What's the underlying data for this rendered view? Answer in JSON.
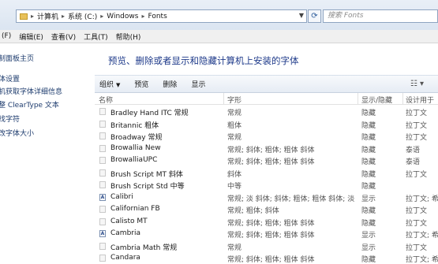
{
  "address_bar": {
    "crumbs": [
      "计算机",
      "系统 (C:)",
      "Windows",
      "Fonts"
    ],
    "search_placeholder": "搜索 Fonts"
  },
  "menu": [
    "(F)",
    "编辑(E)",
    "查看(V)",
    "工具(T)",
    "帮助(H)"
  ],
  "nav_links": [
    "制面板主页",
    "体设置",
    "机获取字体详细信息",
    "整 ClearType 文本",
    "找字符",
    "改字体大小"
  ],
  "heading": "预览、删除或者显示和隐藏计算机上安装的字体",
  "toolbar": {
    "organize": "组织",
    "preview": "预览",
    "delete": "删除",
    "show": "显示"
  },
  "columns": [
    "名称",
    "字形",
    "显示/隐藏",
    "设计用于"
  ],
  "fonts": [
    {
      "name": "Bradley Hand ITC 常规",
      "style": "常规",
      "visibility": "隐藏",
      "designed_for": "拉丁文",
      "truetype": false
    },
    {
      "name": "Britannic 粗体",
      "style": "粗体",
      "visibility": "隐藏",
      "designed_for": "拉丁文",
      "truetype": false
    },
    {
      "name": "Broadway 常规",
      "style": "常规",
      "visibility": "隐藏",
      "designed_for": "拉丁文",
      "truetype": false
    },
    {
      "name": "Browallia New",
      "style": "常规; 斜体; 粗体; 粗体 斜体",
      "visibility": "隐藏",
      "designed_for": "泰语",
      "truetype": false
    },
    {
      "name": "BrowalliaUPC",
      "style": "常规; 斜体; 粗体; 粗体 斜体",
      "visibility": "隐藏",
      "designed_for": "泰语",
      "truetype": false
    },
    {
      "name": "Brush Script MT 斜体",
      "style": "斜体",
      "visibility": "隐藏",
      "designed_for": "拉丁文",
      "truetype": false
    },
    {
      "name": "Brush Script Std 中等",
      "style": "中等",
      "visibility": "隐藏",
      "designed_for": "",
      "truetype": false
    },
    {
      "name": "Calibri",
      "style": "常规; 淡 斜体; 斜体; 粗体; 粗体 斜体; 淡",
      "visibility": "显示",
      "designed_for": "拉丁文; 希腊",
      "truetype": true
    },
    {
      "name": "Californian FB",
      "style": "常规; 粗体; 斜体",
      "visibility": "隐藏",
      "designed_for": "拉丁文",
      "truetype": false
    },
    {
      "name": "Calisto MT",
      "style": "常规; 斜体; 粗体; 粗体 斜体",
      "visibility": "隐藏",
      "designed_for": "拉丁文",
      "truetype": false
    },
    {
      "name": "Cambria",
      "style": "常规; 斜体; 粗体; 粗体 斜体",
      "visibility": "显示",
      "designed_for": "拉丁文; 希腊",
      "truetype": true
    },
    {
      "name": "Cambria Math 常规",
      "style": "常规",
      "visibility": "显示",
      "designed_for": "拉丁文",
      "truetype": false
    },
    {
      "name": "Candara",
      "style": "常规; 斜体; 粗体; 粗体 斜体",
      "visibility": "隐藏",
      "designed_for": "拉丁文; 希腊",
      "truetype": false
    }
  ]
}
